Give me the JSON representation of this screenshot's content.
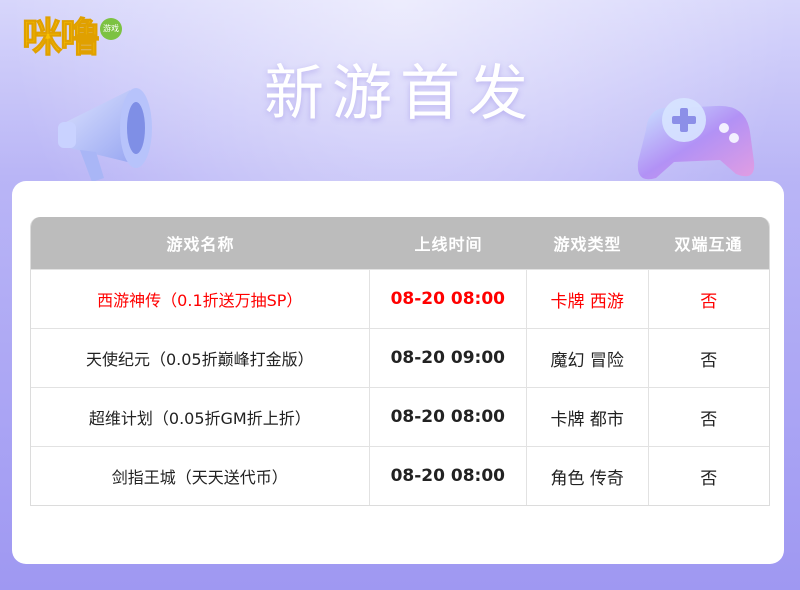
{
  "logo": {
    "text": "咪噜",
    "badge": "游戏"
  },
  "page": {
    "title": "新游首发"
  },
  "table": {
    "headers": [
      "游戏名称",
      "上线时间",
      "游戏类型",
      "双端互通"
    ],
    "rows": [
      [
        "西游神传（0.1折送万抽SP）",
        "08-20 08:00",
        "卡牌 西游",
        "否"
      ],
      [
        "天使纪元（0.05折巅峰打金版）",
        "08-20 09:00",
        "魔幻 冒险",
        "否"
      ],
      [
        "超维计划（0.05折GM折上折）",
        "08-20 08:00",
        "卡牌 都市",
        "否"
      ],
      [
        "剑指王城（天天送代币）",
        "08-20 08:00",
        "角色 传奇",
        "否"
      ]
    ]
  },
  "colors": {
    "highlight": "#ff0000",
    "header_bg": "#bcbcbc",
    "logo": "#f9c100",
    "background": "#9f98f2"
  },
  "icons": [
    "megaphone-icon",
    "gamepad-icon"
  ]
}
